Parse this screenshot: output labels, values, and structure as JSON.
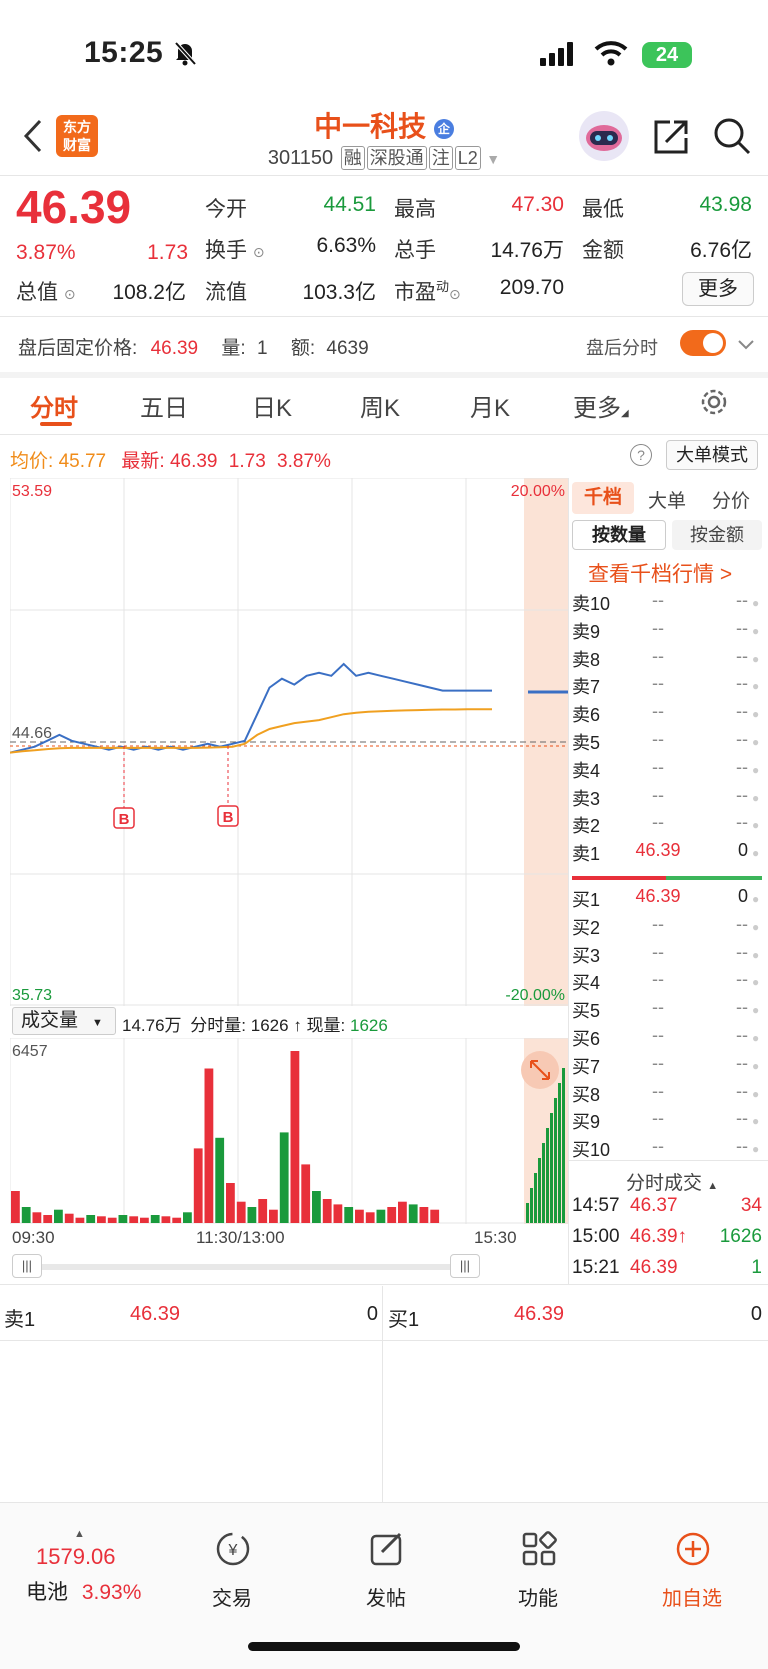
{
  "status_bar": {
    "time": "15:25",
    "battery": "24"
  },
  "header": {
    "title": "中一科技",
    "title_badge": "企",
    "code": "301150",
    "tags": [
      "融",
      "深股通",
      "注",
      "L2"
    ],
    "logo_line1": "东方",
    "logo_line2": "财富"
  },
  "quote": {
    "price": "46.39",
    "change_pct": "3.87%",
    "change": "1.73",
    "open_label": "今开",
    "open": "44.51",
    "high_label": "最高",
    "high": "47.30",
    "low_label": "最低",
    "low": "43.98",
    "turnover_label": "换手",
    "turnover": "6.63%",
    "volume_label": "总手",
    "volume": "14.76万",
    "amount_label": "金额",
    "amount": "6.76亿",
    "mktcap_label": "总值",
    "mktcap": "108.2亿",
    "float_label": "流值",
    "float_cap": "103.3亿",
    "pe_label": "市盈",
    "pe_sup": "动",
    "pe": "209.70",
    "more_label": "更多"
  },
  "after_hours": {
    "fixed_price_label": "盘后固定价格:",
    "fixed_price": "46.39",
    "qty_label": "量:",
    "qty": "1",
    "amt_label": "额:",
    "amt": "4639",
    "timeshare_label": "盘后分时"
  },
  "tabs": [
    "分时",
    "五日",
    "日K",
    "周K",
    "月K",
    "更多"
  ],
  "chart_header": {
    "avg_label": "均价:",
    "avg": "45.77",
    "latest_label": "最新:",
    "latest": "46.39",
    "latest_change": "1.73",
    "latest_pct": "3.87%",
    "big_order_mode": "大单模式"
  },
  "chart_axes": {
    "y_top": "53.59",
    "y_bottom": "35.73",
    "y_ref": "44.66",
    "pct_top": "20.00%",
    "pct_bottom": "-20.00%",
    "time_start": "09:30",
    "time_mid": "11:30/13:00",
    "time_end": "15:30",
    "buy_marker": "B"
  },
  "volume_header": {
    "selector": "成交量",
    "total": "14.76万",
    "minute_vol_label": "分时量:",
    "minute_vol": "1626",
    "current_vol_label": "现量:",
    "current_vol": "1626",
    "max_label": "6457"
  },
  "chart_data": {
    "type": "line",
    "title": "",
    "xlabel": "",
    "ylabel": "",
    "ylim": [
      35.73,
      53.59
    ],
    "series": [
      {
        "name": "",
        "values": [
          44.3,
          44.4,
          44.5,
          44.7,
          44.9,
          44.7,
          44.6,
          44.5,
          44.4,
          44.5,
          44.4,
          44.5,
          44.4,
          44.5,
          44.4,
          44.5,
          44.6,
          44.5,
          44.6,
          44.7,
          45.6,
          46.5,
          46.8,
          46.6,
          46.9,
          47.0,
          46.9,
          47.3,
          46.9,
          47.0,
          46.9,
          46.8,
          46.7,
          46.6,
          46.5,
          46.4,
          46.4,
          46.4,
          46.4,
          46.4
        ]
      },
      {
        "name": "",
        "values": [
          44.3,
          44.35,
          44.38,
          44.42,
          44.45,
          44.46,
          44.46,
          44.46,
          44.46,
          44.46,
          44.46,
          44.46,
          44.46,
          44.46,
          44.46,
          44.46,
          44.47,
          44.48,
          44.5,
          44.6,
          44.9,
          45.1,
          45.2,
          45.3,
          45.35,
          45.4,
          45.5,
          45.6,
          45.65,
          45.68,
          45.7,
          45.72,
          45.73,
          45.74,
          45.75,
          45.76,
          45.76,
          45.77,
          45.77,
          45.77
        ]
      }
    ],
    "volumes": [
      1200,
      600,
      400,
      300,
      500,
      350,
      200,
      300,
      250,
      200,
      300,
      250,
      200,
      300,
      250,
      200,
      400,
      2800,
      5800,
      3200,
      1500,
      800,
      600,
      900,
      500,
      3400,
      6457,
      2200,
      1200,
      900,
      700,
      600,
      500,
      400,
      500,
      600,
      800,
      700,
      600,
      500
    ]
  },
  "book": {
    "tabs": [
      "千档",
      "大单",
      "分价"
    ],
    "sub_tabs": [
      "按数量",
      "按金额"
    ],
    "view_more": "查看千档行情 >",
    "sells": [
      {
        "label": "卖10",
        "price": "--",
        "vol": "--"
      },
      {
        "label": "卖9",
        "price": "--",
        "vol": "--"
      },
      {
        "label": "卖8",
        "price": "--",
        "vol": "--"
      },
      {
        "label": "卖7",
        "price": "--",
        "vol": "--"
      },
      {
        "label": "卖6",
        "price": "--",
        "vol": "--"
      },
      {
        "label": "卖5",
        "price": "--",
        "vol": "--"
      },
      {
        "label": "卖4",
        "price": "--",
        "vol": "--"
      },
      {
        "label": "卖3",
        "price": "--",
        "vol": "--"
      },
      {
        "label": "卖2",
        "price": "--",
        "vol": "--"
      },
      {
        "label": "卖1",
        "price": "46.39",
        "vol": "0"
      }
    ],
    "buys": [
      {
        "label": "买1",
        "price": "46.39",
        "vol": "0"
      },
      {
        "label": "买2",
        "price": "--",
        "vol": "--"
      },
      {
        "label": "买3",
        "price": "--",
        "vol": "--"
      },
      {
        "label": "买4",
        "price": "--",
        "vol": "--"
      },
      {
        "label": "买5",
        "price": "--",
        "vol": "--"
      },
      {
        "label": "买6",
        "price": "--",
        "vol": "--"
      },
      {
        "label": "买7",
        "price": "--",
        "vol": "--"
      },
      {
        "label": "买8",
        "price": "--",
        "vol": "--"
      },
      {
        "label": "买9",
        "price": "--",
        "vol": "--"
      },
      {
        "label": "买10",
        "price": "--",
        "vol": "--"
      }
    ],
    "trades_label": "分时成交",
    "trades": [
      {
        "time": "14:57",
        "price": "46.37",
        "vol": "34"
      },
      {
        "time": "15:00",
        "price": "46.39↑",
        "vol": "1626"
      },
      {
        "time": "15:21",
        "price": "46.39",
        "vol": "1"
      }
    ]
  },
  "bottom_quote": {
    "sell_label": "卖1",
    "sell_price": "46.39",
    "sell_vol": "0",
    "buy_label": "买1",
    "buy_price": "46.39",
    "buy_vol": "0"
  },
  "bottom_nav": {
    "index_value": "1579.06",
    "index_name": "电池",
    "index_pct": "3.93%",
    "items": [
      "交易",
      "发帖",
      "功能",
      "加自选"
    ]
  },
  "colors": {
    "up": "#e8303a",
    "down": "#1a9a3c",
    "accent": "#e8501a",
    "price_line": "#3a6fc4",
    "avg_line": "#f0a020"
  }
}
